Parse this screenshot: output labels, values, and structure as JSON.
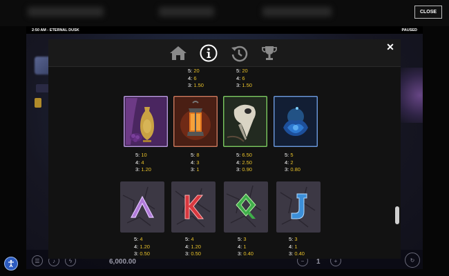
{
  "header": {
    "close_label": "CLOSE"
  },
  "status_bar": {
    "time_title": "2:50 AM - ETERNAL DUSK",
    "state": "PAUSED"
  },
  "bottom_bar": {
    "balance": "6,000.00",
    "bet_count": "1"
  },
  "modal": {
    "tabs": [
      {
        "name": "home",
        "icon": "home-icon"
      },
      {
        "name": "info",
        "icon": "info-icon",
        "active": true
      },
      {
        "name": "history",
        "icon": "history-icon"
      },
      {
        "name": "trophy",
        "icon": "trophy-icon"
      }
    ],
    "close_symbol": "✕"
  },
  "paytable": {
    "partial_row": [
      {
        "lines": [
          [
            "5:",
            "20"
          ],
          [
            "4:",
            "6"
          ],
          [
            "3:",
            "1.50"
          ]
        ]
      },
      {
        "lines": [
          [
            "5:",
            "20"
          ],
          [
            "4:",
            "6"
          ],
          [
            "3:",
            "1.50"
          ]
        ]
      }
    ],
    "symbols_row1": [
      {
        "symbol": "vase",
        "frame_color": "#a07ad0",
        "lines": [
          [
            "5:",
            "10"
          ],
          [
            "4:",
            "4"
          ],
          [
            "3:",
            "1.20"
          ]
        ]
      },
      {
        "symbol": "lantern",
        "frame_color": "#d06a3a",
        "lines": [
          [
            "5:",
            "8"
          ],
          [
            "4:",
            "3"
          ],
          [
            "3:",
            "1"
          ]
        ]
      },
      {
        "symbol": "bird-skull",
        "frame_color": "#6fbf5a",
        "lines": [
          [
            "5:",
            "6.50"
          ],
          [
            "4:",
            "2.50"
          ],
          [
            "3:",
            "0.90"
          ]
        ]
      },
      {
        "symbol": "blue-rose",
        "frame_color": "#5a86d0",
        "lines": [
          [
            "5:",
            "5"
          ],
          [
            "4:",
            "2"
          ],
          [
            "3:",
            "0.80"
          ]
        ]
      }
    ],
    "symbols_row2": [
      {
        "symbol": "ace",
        "glyph": "Λ",
        "glyph_color": "#b07ad8",
        "lines": [
          [
            "5:",
            "4"
          ],
          [
            "4:",
            "1.20"
          ],
          [
            "3:",
            "0.50"
          ]
        ]
      },
      {
        "symbol": "king",
        "glyph": "K",
        "glyph_color": "#d8383f",
        "lines": [
          [
            "5:",
            "4"
          ],
          [
            "4:",
            "1.20"
          ],
          [
            "3:",
            "0.50"
          ]
        ]
      },
      {
        "symbol": "queen",
        "glyph": "Q",
        "glyph_color": "#3fae4a",
        "lines": [
          [
            "5:",
            "3"
          ],
          [
            "4:",
            "1"
          ],
          [
            "3:",
            "0.40"
          ]
        ]
      },
      {
        "symbol": "jack",
        "glyph": "J",
        "glyph_color": "#3c8fd8",
        "lines": [
          [
            "5:",
            "3"
          ],
          [
            "4:",
            "1"
          ],
          [
            "3:",
            "0.40"
          ]
        ]
      }
    ]
  },
  "colors": {
    "payout_gold": "#e8c12a",
    "modal_bg": "#161616",
    "accent_blue": "#2c5bbf"
  }
}
